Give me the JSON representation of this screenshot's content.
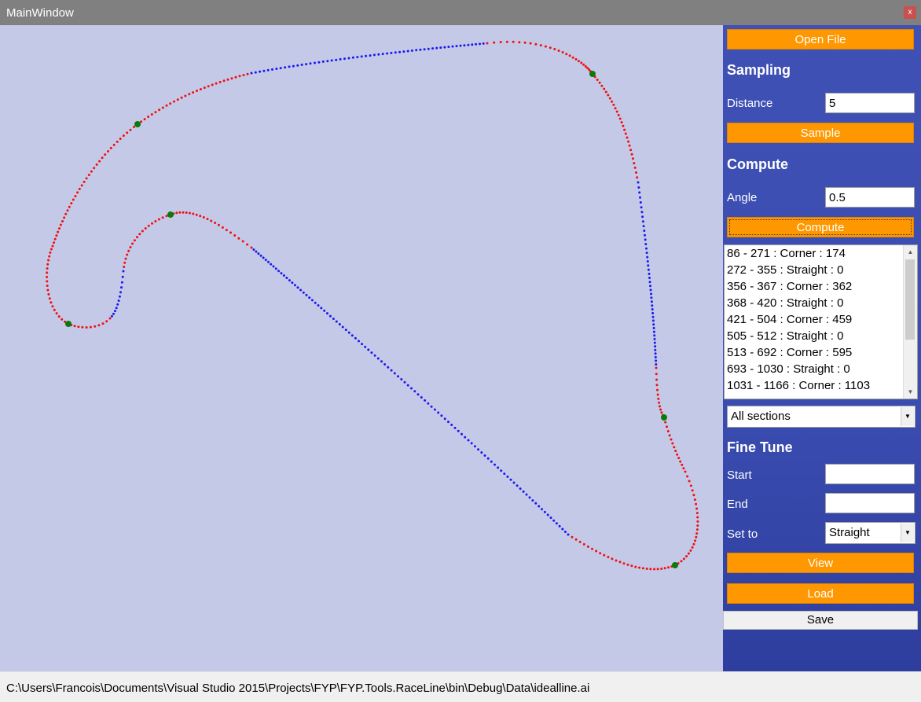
{
  "window": {
    "title": "MainWindow",
    "close_label": "x"
  },
  "canvas": {
    "background": "#c5c9e8",
    "corner_color": "#ee1111",
    "straight_color": "#1a1aee",
    "marker_color": "#0a7a0a"
  },
  "panel": {
    "open_file_label": "Open File",
    "sampling": {
      "heading": "Sampling",
      "distance_label": "Distance",
      "distance_value": "5",
      "sample_label": "Sample"
    },
    "compute": {
      "heading": "Compute",
      "angle_label": "Angle",
      "angle_value": "0.5",
      "compute_label": "Compute"
    },
    "sections_list": [
      "86 - 271 : Corner : 174",
      "272 - 355 : Straight : 0",
      "356 - 367 : Corner : 362",
      "368 - 420 : Straight : 0",
      "421 - 504 : Corner : 459",
      "505 - 512 : Straight : 0",
      "513 - 692 : Corner : 595",
      "693 - 1030 : Straight : 0",
      "1031 - 1166 : Corner : 1103"
    ],
    "filter_selected": "All sections",
    "fine_tune": {
      "heading": "Fine Tune",
      "start_label": "Start",
      "start_value": "",
      "end_label": "End",
      "end_value": "",
      "set_to_label": "Set to",
      "set_to_selected": "Straight",
      "view_label": "View",
      "load_label": "Load",
      "save_label": "Save"
    }
  },
  "status": {
    "path": "C:\\Users\\Francois\\Documents\\Visual Studio 2015\\Projects\\FYP\\FYP.Tools.RaceLine\\bin\\Debug\\Data\\idealline.ai"
  }
}
